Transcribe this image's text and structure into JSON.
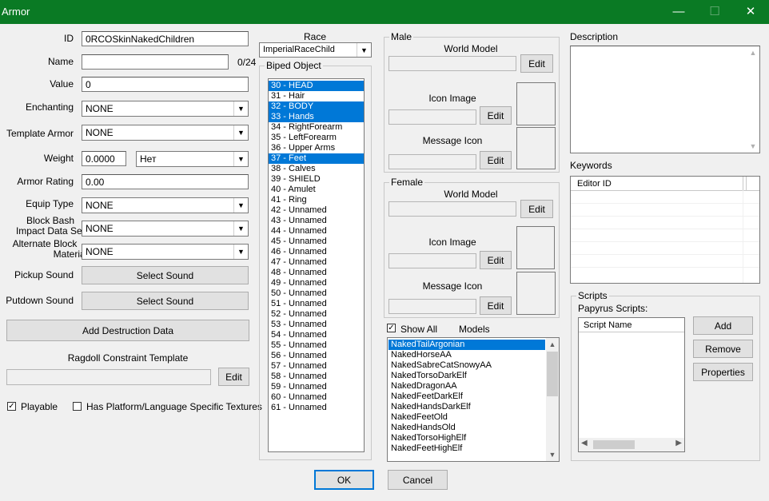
{
  "window": {
    "title": "Armor",
    "minimize_glyph": "—",
    "maximize_glyph": "☐",
    "close_glyph": "✕"
  },
  "form": {
    "id_label": "ID",
    "id_value": "0RCOSkinNakedChildren",
    "name_label": "Name",
    "name_value": "",
    "name_counter": "0/24",
    "value_label": "Value",
    "value_value": "0",
    "enchanting_label": "Enchanting",
    "enchanting_value": "NONE",
    "template_label": "Template Armor",
    "template_value": "NONE",
    "weight_label": "Weight",
    "weight_value": "0.0000",
    "weight_type_value": "Нет",
    "armor_rating_label": "Armor Rating",
    "armor_rating_value": "0.00",
    "equip_type_label": "Equip Type",
    "equip_type_value": "NONE",
    "block_bash_label_1": "Block Bash",
    "block_bash_label_2": "Impact Data Set",
    "block_bash_value": "NONE",
    "alt_block_label_1": "Alternate Block",
    "alt_block_label_2": "Material",
    "alt_block_value": "NONE",
    "pickup_label": "Pickup Sound",
    "pickup_button": "Select Sound",
    "putdown_label": "Putdown Sound",
    "putdown_button": "Select Sound",
    "destruction_button": "Add Destruction Data",
    "ragdoll_label": "Ragdoll Constraint Template",
    "ragdoll_value": "",
    "ragdoll_edit": "Edit",
    "playable_label": "Playable",
    "playable_checked": true,
    "platform_label": "Has Platform/Language Specific Textures",
    "platform_checked": false
  },
  "race": {
    "label": "Race",
    "value": "ImperialRaceChild"
  },
  "biped": {
    "label": "Biped Object",
    "items": [
      {
        "text": "30 - HEAD",
        "selected": true
      },
      {
        "text": "31 - Hair",
        "selected": false
      },
      {
        "text": "32 - BODY",
        "selected": true
      },
      {
        "text": "33 - Hands",
        "selected": true
      },
      {
        "text": "34 - RightForearm",
        "selected": false
      },
      {
        "text": "35 - LeftForearm",
        "selected": false
      },
      {
        "text": "36 - Upper Arms",
        "selected": false
      },
      {
        "text": "37 - Feet",
        "selected": true
      },
      {
        "text": "38 - Calves",
        "selected": false
      },
      {
        "text": "39 - SHIELD",
        "selected": false
      },
      {
        "text": "40 - Amulet",
        "selected": false
      },
      {
        "text": "41 - Ring",
        "selected": false
      },
      {
        "text": "42 - Unnamed",
        "selected": false
      },
      {
        "text": "43 - Unnamed",
        "selected": false
      },
      {
        "text": "44 - Unnamed",
        "selected": false
      },
      {
        "text": "45 - Unnamed",
        "selected": false
      },
      {
        "text": "46 - Unnamed",
        "selected": false
      },
      {
        "text": "47 - Unnamed",
        "selected": false
      },
      {
        "text": "48 - Unnamed",
        "selected": false
      },
      {
        "text": "49 - Unnamed",
        "selected": false
      },
      {
        "text": "50 - Unnamed",
        "selected": false
      },
      {
        "text": "51 - Unnamed",
        "selected": false
      },
      {
        "text": "52 - Unnamed",
        "selected": false
      },
      {
        "text": "53 - Unnamed",
        "selected": false
      },
      {
        "text": "54 - Unnamed",
        "selected": false
      },
      {
        "text": "55 - Unnamed",
        "selected": false
      },
      {
        "text": "56 - Unnamed",
        "selected": false
      },
      {
        "text": "57 - Unnamed",
        "selected": false
      },
      {
        "text": "58 - Unnamed",
        "selected": false
      },
      {
        "text": "59 - Unnamed",
        "selected": false
      },
      {
        "text": "60 - Unnamed",
        "selected": false
      },
      {
        "text": "61 - Unnamed",
        "selected": false
      }
    ]
  },
  "male": {
    "label": "Male",
    "world_model_label": "World Model",
    "world_model_value": "",
    "world_model_edit": "Edit",
    "icon_image_label": "Icon Image",
    "icon_image_value": "",
    "icon_image_edit": "Edit",
    "message_icon_label": "Message Icon",
    "message_icon_value": "",
    "message_icon_edit": "Edit"
  },
  "female": {
    "label": "Female",
    "world_model_label": "World Model",
    "world_model_value": "",
    "world_model_edit": "Edit",
    "icon_image_label": "Icon Image",
    "icon_image_value": "",
    "icon_image_edit": "Edit",
    "message_icon_label": "Message Icon",
    "message_icon_value": "",
    "message_icon_edit": "Edit"
  },
  "models": {
    "show_all_label": "Show All",
    "show_all_checked": true,
    "label": "Models",
    "items": [
      {
        "text": "NakedTailArgonian",
        "selected": true
      },
      {
        "text": "NakedHorseAA",
        "selected": false
      },
      {
        "text": "NakedSabreCatSnowyAA",
        "selected": false
      },
      {
        "text": "NakedTorsoDarkElf",
        "selected": false
      },
      {
        "text": "NakedDragonAA",
        "selected": false
      },
      {
        "text": "NakedFeetDarkElf",
        "selected": false
      },
      {
        "text": "NakedHandsDarkElf",
        "selected": false
      },
      {
        "text": "NakedFeetOld",
        "selected": false
      },
      {
        "text": "NakedHandsOld",
        "selected": false
      },
      {
        "text": "NakedTorsoHighElf",
        "selected": false
      },
      {
        "text": "NakedFeetHighElf",
        "selected": false
      }
    ]
  },
  "description": {
    "label": "Description",
    "value": ""
  },
  "keywords": {
    "label": "Keywords",
    "column": "Editor ID"
  },
  "scripts": {
    "label": "Scripts",
    "papyrus_label": "Papyrus Scripts:",
    "column": "Script Name",
    "add": "Add",
    "remove": "Remove",
    "properties": "Properties"
  },
  "footer": {
    "ok": "OK",
    "cancel": "Cancel"
  }
}
